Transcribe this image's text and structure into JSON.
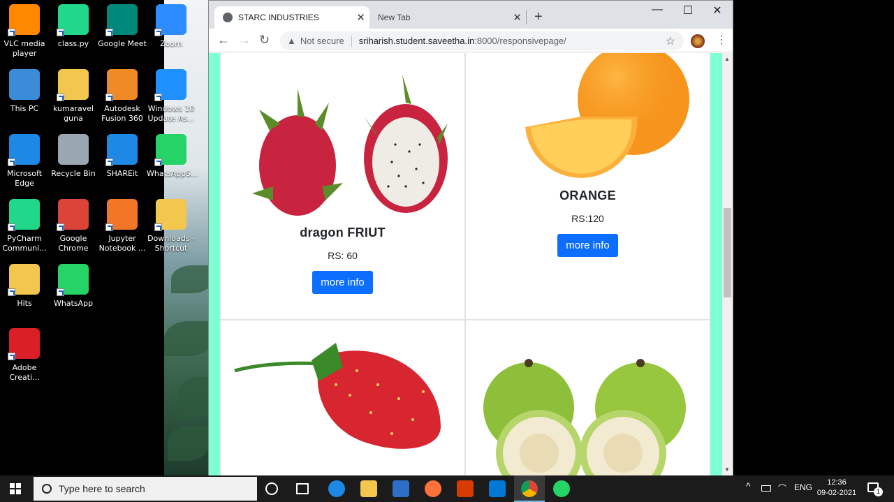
{
  "desktop": {
    "icons": [
      {
        "label": "VLC media player",
        "icon": "vlc-icon",
        "color": "#ff8800"
      },
      {
        "label": "class.py",
        "icon": "pycharm-file-icon",
        "color": "#21d789"
      },
      {
        "label": "Google Meet",
        "icon": "google-meet-icon",
        "color": "#00897b"
      },
      {
        "label": "Zoom",
        "icon": "zoom-icon",
        "color": "#2d8cff"
      },
      {
        "label": "This PC",
        "icon": "computer-icon",
        "color": "#3a8bd8"
      },
      {
        "label": "kumaravel guna",
        "icon": "user-folder-icon",
        "color": "#f3c74e"
      },
      {
        "label": "Autodesk Fusion 360",
        "icon": "fusion360-icon",
        "color": "#f08a24"
      },
      {
        "label": "Windows 10 Update As...",
        "icon": "windows-update-icon",
        "color": "#1e90ff"
      },
      {
        "label": "Microsoft Edge",
        "icon": "edge-icon",
        "color": "#1e88e5"
      },
      {
        "label": "Recycle Bin",
        "icon": "recycle-bin-icon",
        "color": "#9aa6b2"
      },
      {
        "label": "SHAREit",
        "icon": "shareit-icon",
        "color": "#1e88e5"
      },
      {
        "label": "WhatsAppS...",
        "icon": "whatsapp-icon",
        "color": "#25d366"
      },
      {
        "label": "PyCharm Communi...",
        "icon": "pycharm-icon",
        "color": "#21d789"
      },
      {
        "label": "Google Chrome",
        "icon": "chrome-icon",
        "color": "#db4437"
      },
      {
        "label": "Jupyter Notebook ...",
        "icon": "jupyter-icon",
        "color": "#f37626"
      },
      {
        "label": "Downloads - Shortcut",
        "icon": "downloads-folder-icon",
        "color": "#f3c74e"
      },
      {
        "label": "Hits",
        "icon": "folder-icon",
        "color": "#f3c74e"
      },
      {
        "label": "WhatsApp",
        "icon": "whatsapp-icon",
        "color": "#25d366"
      },
      {
        "label": "Adobe Creati...",
        "icon": "adobe-cc-icon",
        "color": "#da1f26"
      }
    ]
  },
  "browser": {
    "tabs": [
      {
        "label": "STARC INDUSTRIES",
        "active": true
      },
      {
        "label": "New Tab",
        "active": false
      }
    ],
    "new_tab_glyph": "+",
    "window_controls": {
      "minimize": "—",
      "maximize": "☐",
      "close": "✕"
    },
    "security_label": "Not secure",
    "url_host": "sriharish.student.saveetha.in",
    "url_rest": ":8000/responsivepage/"
  },
  "page": {
    "background": "#7fffd4",
    "cards": [
      {
        "title": "dragon FRIUT",
        "price": "RS: 60",
        "button": "more info",
        "image": "dragon-fruit-image"
      },
      {
        "title": "ORANGE",
        "price": "RS:120",
        "button": "more info",
        "image": "orange-image"
      },
      {
        "title": "",
        "price": "",
        "button": "",
        "image": "strawberry-image"
      },
      {
        "title": "",
        "price": "",
        "button": "",
        "image": "guava-image"
      }
    ],
    "button_color": "#0d6efd"
  },
  "taskbar": {
    "search_placeholder": "Type here to search",
    "language": "ENG",
    "time": "12:36",
    "date": "09-02-2021",
    "notification_count": "1"
  }
}
